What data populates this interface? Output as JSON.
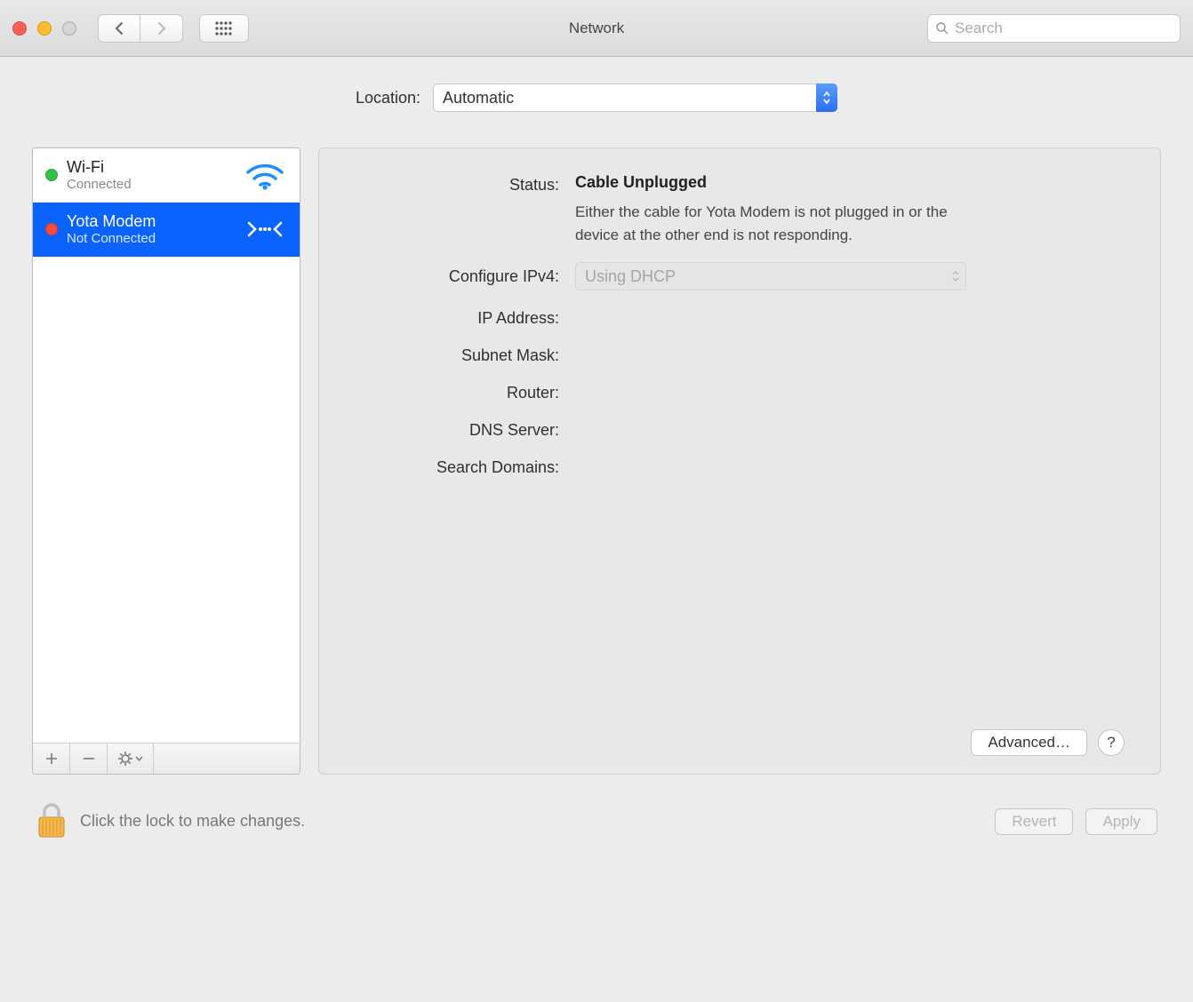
{
  "window": {
    "title": "Network"
  },
  "search": {
    "placeholder": "Search"
  },
  "location": {
    "label": "Location:",
    "value": "Automatic"
  },
  "services": [
    {
      "name": "Wi-Fi",
      "status": "Connected",
      "dot": "green",
      "icon": "wifi",
      "selected": false
    },
    {
      "name": "Yota Modem",
      "status": "Not Connected",
      "dot": "red",
      "icon": "ethernet",
      "selected": true
    }
  ],
  "detail": {
    "status_label": "Status:",
    "status_value": "Cable Unplugged",
    "status_desc": "Either the cable for Yota Modem is not plugged in or the device at the other end is not responding.",
    "configure_label": "Configure IPv4:",
    "configure_value": "Using DHCP",
    "ip_label": "IP Address:",
    "subnet_label": "Subnet Mask:",
    "router_label": "Router:",
    "dns_label": "DNS Server:",
    "search_domains_label": "Search Domains:",
    "advanced_button": "Advanced…"
  },
  "footer": {
    "lock_text": "Click the lock to make changes.",
    "revert": "Revert",
    "apply": "Apply"
  }
}
